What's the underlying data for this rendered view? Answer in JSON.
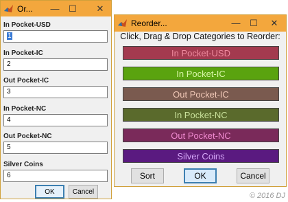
{
  "left_window": {
    "title": "Or...",
    "controls": {
      "minimize": "—",
      "maximize": "☐",
      "close": "✕"
    },
    "fields": [
      {
        "label": "In Pocket-USD",
        "value": "1"
      },
      {
        "label": "In Pocket-IC",
        "value": "2"
      },
      {
        "label": "Out Pocket-IC",
        "value": "3"
      },
      {
        "label": "In Pocket-NC",
        "value": "4"
      },
      {
        "label": "Out Pocket-NC",
        "value": "5"
      },
      {
        "label": "Silver Coins",
        "value": "6"
      }
    ],
    "ok_label": "OK",
    "cancel_label": "Cancel"
  },
  "right_window": {
    "title": "Reorder...",
    "controls": {
      "minimize": "—",
      "maximize": "☐",
      "close": "✕"
    },
    "instruction": "Click, Drag & Drop Categories to Reorder:",
    "categories": [
      {
        "label": "In Pocket-USD",
        "bg": "#a33a4f",
        "fg": "#f08ca0"
      },
      {
        "label": "In Pocket-IC",
        "bg": "#5aa30f",
        "fg": "#d8f5a8"
      },
      {
        "label": "Out Pocket-IC",
        "bg": "#7a5a4f",
        "fg": "#f2c9b8"
      },
      {
        "label": "In Pocket-NC",
        "bg": "#5a6a2c",
        "fg": "#c8e09a"
      },
      {
        "label": "Out Pocket-NC",
        "bg": "#7a2a5a",
        "fg": "#f08ad0"
      },
      {
        "label": "Silver Coins",
        "bg": "#5a1a80",
        "fg": "#d6a8f8"
      }
    ],
    "sort_label": "Sort",
    "ok_label": "OK",
    "cancel_label": "Cancel"
  },
  "watermark": "© 2016 DJ"
}
